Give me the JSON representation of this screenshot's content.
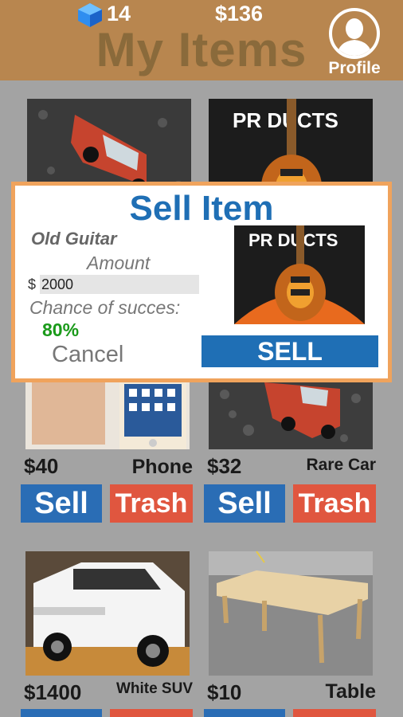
{
  "header": {
    "gems": "14",
    "money": "$136",
    "title": "My Items",
    "profile_label": "Profile"
  },
  "items": [
    {
      "price": "",
      "name": "",
      "photo": "toy-car-photo"
    },
    {
      "price": "",
      "name": "",
      "photo": "guitar-photo"
    },
    {
      "price": "$40",
      "name": "Phone",
      "sell_label": "Sell",
      "trash_label": "Trash",
      "photo": "phone-photo"
    },
    {
      "price": "$32",
      "name": "Rare Car",
      "sell_label": "Sell",
      "trash_label": "Trash",
      "photo": "toy-car-photo"
    },
    {
      "price": "$1400",
      "name": "White SUV",
      "photo": "suv-photo"
    },
    {
      "price": "$10",
      "name": "Table",
      "photo": "table-photo"
    }
  ],
  "modal": {
    "title": "Sell Item",
    "item_name": "Old Guitar",
    "amount_label": "Amount",
    "currency": "$",
    "amount_value": "2000",
    "chance_label": "Chance of succes:",
    "chance_value": "80%",
    "cancel_label": "Cancel",
    "sell_label": "SELL"
  },
  "colors": {
    "header": "#b8864f",
    "sell_button": "#2a6db5",
    "trash_button": "#e0563f",
    "modal_border": "#f0a35c",
    "modal_title": "#1f6fb5",
    "success": "#1a9a1a"
  }
}
